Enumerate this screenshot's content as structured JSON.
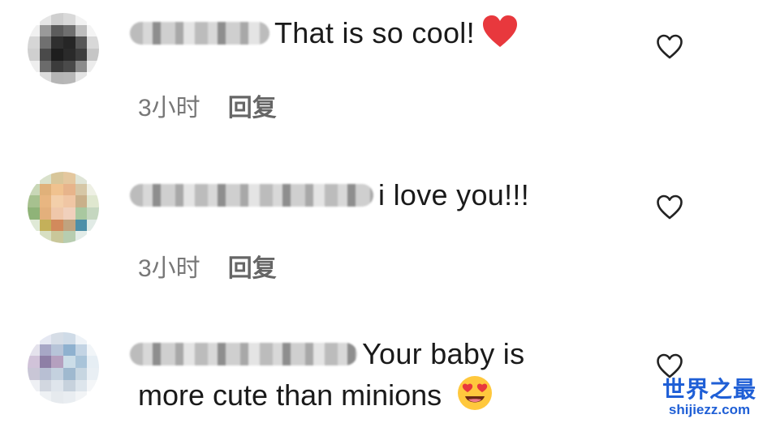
{
  "comments": [
    {
      "text": "That is so cool!",
      "emoji": "red-heart-emoji",
      "time": "3小时",
      "reply": "回复",
      "avatar_colors": [
        "#ffffff",
        "#e6e6e6",
        "#cfcfcf",
        "#d9d9d9",
        "#f2f2f2",
        "#ffffff",
        "#f0f0f0",
        "#9a9a9a",
        "#5c5c5c",
        "#6f6f6f",
        "#bdbdbd",
        "#f4f4f4",
        "#d6d6d6",
        "#707070",
        "#2f2f2f",
        "#262626",
        "#575757",
        "#d8d8d8",
        "#cfcfcf",
        "#4a4a4a",
        "#1e1e1e",
        "#2a2a2a",
        "#3d3d3d",
        "#c6c6c6",
        "#eeeeee",
        "#6b6b6b",
        "#3c3c3c",
        "#4a4a4a",
        "#8b8b8b",
        "#ececec",
        "#ffffff",
        "#dcdcdc",
        "#b5b5b5",
        "#b7b7b7",
        "#e4e4e4",
        "#ffffff"
      ]
    },
    {
      "text": "i love you!!!",
      "emoji": "",
      "time": "3小时",
      "reply": "回复",
      "avatar_colors": [
        "#ffffff",
        "#d9e1cb",
        "#d8c69a",
        "#e4c79e",
        "#dfe4d6",
        "#ffffff",
        "#c9d7b7",
        "#e0b17a",
        "#f0c28f",
        "#e7b48b",
        "#d6c7a6",
        "#eef0e4",
        "#a7c18f",
        "#e8b681",
        "#f3cfaa",
        "#f0c6a4",
        "#c9b08a",
        "#dfe7cf",
        "#8fb378",
        "#e3b07c",
        "#efc7aa",
        "#f0d0bc",
        "#a9c8a0",
        "#c5d7c0",
        "#dfe9d6",
        "#c4b05a",
        "#d28a5c",
        "#c0a37f",
        "#4d8fa8",
        "#e1ebe6",
        "#ffffff",
        "#d7dfc2",
        "#c9c79a",
        "#b7cdb0",
        "#e3ece8",
        "#ffffff"
      ]
    },
    {
      "text": "Your baby is",
      "text2": "more cute than minions",
      "emoji": "heart-eyes-emoji",
      "time": "",
      "reply": "",
      "avatar_colors": [
        "#ffffff",
        "#e5e8f2",
        "#d6dde6",
        "#cfdbe7",
        "#edf2f7",
        "#ffffff",
        "#e4e2ec",
        "#a7a7c6",
        "#b7c4d8",
        "#8fb1cf",
        "#c3d4e4",
        "#f1f5f8",
        "#d1c3d9",
        "#8e7fa6",
        "#b5a0bf",
        "#cbdde8",
        "#a9c4d9",
        "#e6eef4",
        "#c9c6d6",
        "#b8bfd3",
        "#c4d1df",
        "#9fb9cf",
        "#c7d6e1",
        "#e9eff4",
        "#eef0f4",
        "#d2d7e0",
        "#dfe5ec",
        "#c7d2dd",
        "#dde5ec",
        "#f4f6f8",
        "#ffffff",
        "#eef1f4",
        "#e6eaee",
        "#e9edf1",
        "#f2f4f6",
        "#ffffff"
      ]
    }
  ],
  "watermark": {
    "line1": "世界之最",
    "line2": "shijiezz.com"
  },
  "colors": {
    "heart_emoji": "#e8383d",
    "meta_text": "#777777",
    "watermark": "#1f5fd6"
  }
}
